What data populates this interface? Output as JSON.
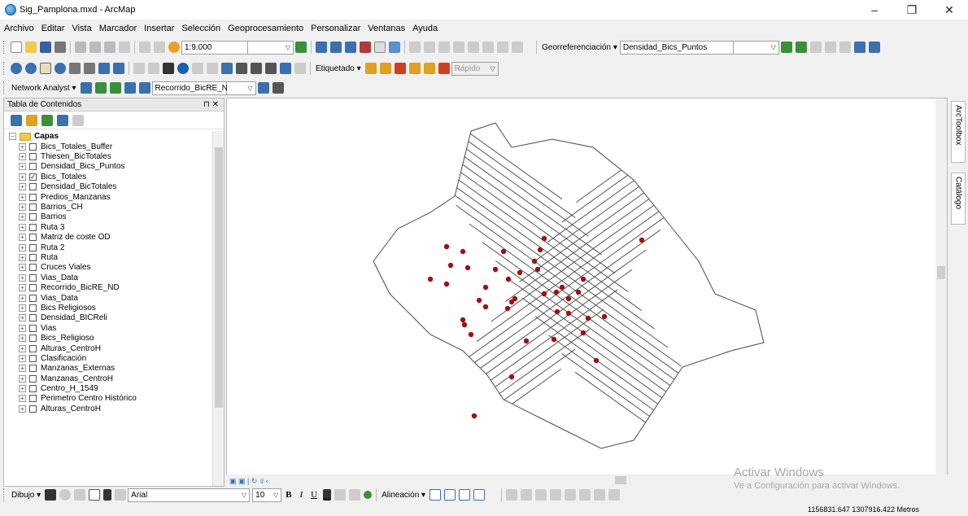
{
  "window": {
    "title": "Sig_Pamplona.mxd - ArcMap",
    "minimize": "–",
    "maximize": "❐",
    "close": "✕"
  },
  "menu": [
    "Archivo",
    "Editar",
    "Vista",
    "Marcador",
    "Insertar",
    "Selección",
    "Geoprocesamiento",
    "Personalizar",
    "Ventanas",
    "Ayuda"
  ],
  "toolbar1": {
    "scale": "1:9.000",
    "georef_label": "Georreferenciación ▾",
    "georef_layer": "Densidad_Bics_Puntos"
  },
  "toolbar2": {
    "etiquetado": "Etiquetado ▾",
    "rapido": "Rápido"
  },
  "toolbar3": {
    "network_analyst": "Network Analyst ▾",
    "route_layer": "Recorrido_BicRE_ND"
  },
  "toc": {
    "title": "Tabla de Contenidos",
    "pin": "⊓ ✕",
    "root": "Capas",
    "layers": [
      {
        "name": "Bics_Totales_Buffer",
        "checked": false
      },
      {
        "name": "Thiesen_BicTotales",
        "checked": false
      },
      {
        "name": "Densidad_Bics_Puntos",
        "checked": false
      },
      {
        "name": "Bics_Totales",
        "checked": true
      },
      {
        "name": "Densidad_BicTotales",
        "checked": false
      },
      {
        "name": "Predios_Manzanas",
        "checked": false
      },
      {
        "name": "Barrios_CH",
        "checked": false
      },
      {
        "name": "Barrios",
        "checked": false
      },
      {
        "name": "Ruta 3",
        "checked": false
      },
      {
        "name": "Matriz de coste OD",
        "checked": false
      },
      {
        "name": "Ruta 2",
        "checked": false
      },
      {
        "name": "Ruta",
        "checked": false
      },
      {
        "name": "Cruces Viales",
        "checked": false
      },
      {
        "name": "Vias_Data",
        "checked": false
      },
      {
        "name": "Recorrido_BicRE_ND",
        "checked": false
      },
      {
        "name": "Vias_Data",
        "checked": false
      },
      {
        "name": "Bics Religiosos",
        "checked": false
      },
      {
        "name": "Densidad_BICReli",
        "checked": false
      },
      {
        "name": "Vias",
        "checked": false
      },
      {
        "name": "Bics_Religioso",
        "checked": false
      },
      {
        "name": "Alturas_CentroH",
        "checked": false
      },
      {
        "name": "Clasificación",
        "checked": false
      },
      {
        "name": "Manzanas_Externas",
        "checked": false
      },
      {
        "name": "Manzanas_CentroH",
        "checked": false
      },
      {
        "name": "Centro_H_1549",
        "checked": false
      },
      {
        "name": "Perimetro Centro Histórico",
        "checked": false
      },
      {
        "name": "Alturas_CentroH",
        "checked": false
      }
    ]
  },
  "dock": {
    "arctoolbox": "ArcToolbox",
    "catalogo": "Catálogo"
  },
  "drawing": {
    "dibujo": "Dibujo ▾",
    "font": "Arial",
    "size": "10",
    "alineacion": "Alineación ▾"
  },
  "status": {
    "coords": "1156831.647  1307916.422 Metros"
  },
  "watermark": {
    "line1": "Activar Windows",
    "line2": "Ve a Configuración para activar Windows."
  },
  "colors": {
    "point": "#a01010",
    "street": "#555555"
  }
}
